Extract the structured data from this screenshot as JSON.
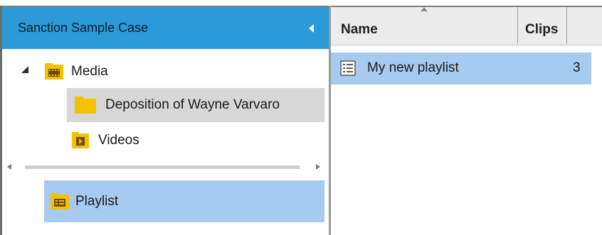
{
  "case": {
    "title": "Sanction Sample Case",
    "header_color": "#2b9ad8"
  },
  "tree": {
    "items": [
      {
        "label": "Media",
        "icon": "media-folder-icon",
        "expanded": true
      },
      {
        "label": "Deposition of Wayne Varvaro",
        "icon": "folder-icon",
        "selected": true
      },
      {
        "label": "Videos",
        "icon": "video-folder-icon"
      }
    ],
    "playlist": {
      "label": "Playlist",
      "icon": "playlist-folder-icon"
    }
  },
  "grid": {
    "columns": [
      {
        "label": "Name",
        "sorted": "ascending"
      },
      {
        "label": "Clips"
      }
    ],
    "rows": [
      {
        "name": "My new playlist",
        "clips": "3",
        "icon": "playlist-icon"
      }
    ]
  },
  "colors": {
    "selection": "#a7caef",
    "hover": "#d7d7d7",
    "folder": "#f4c000"
  }
}
